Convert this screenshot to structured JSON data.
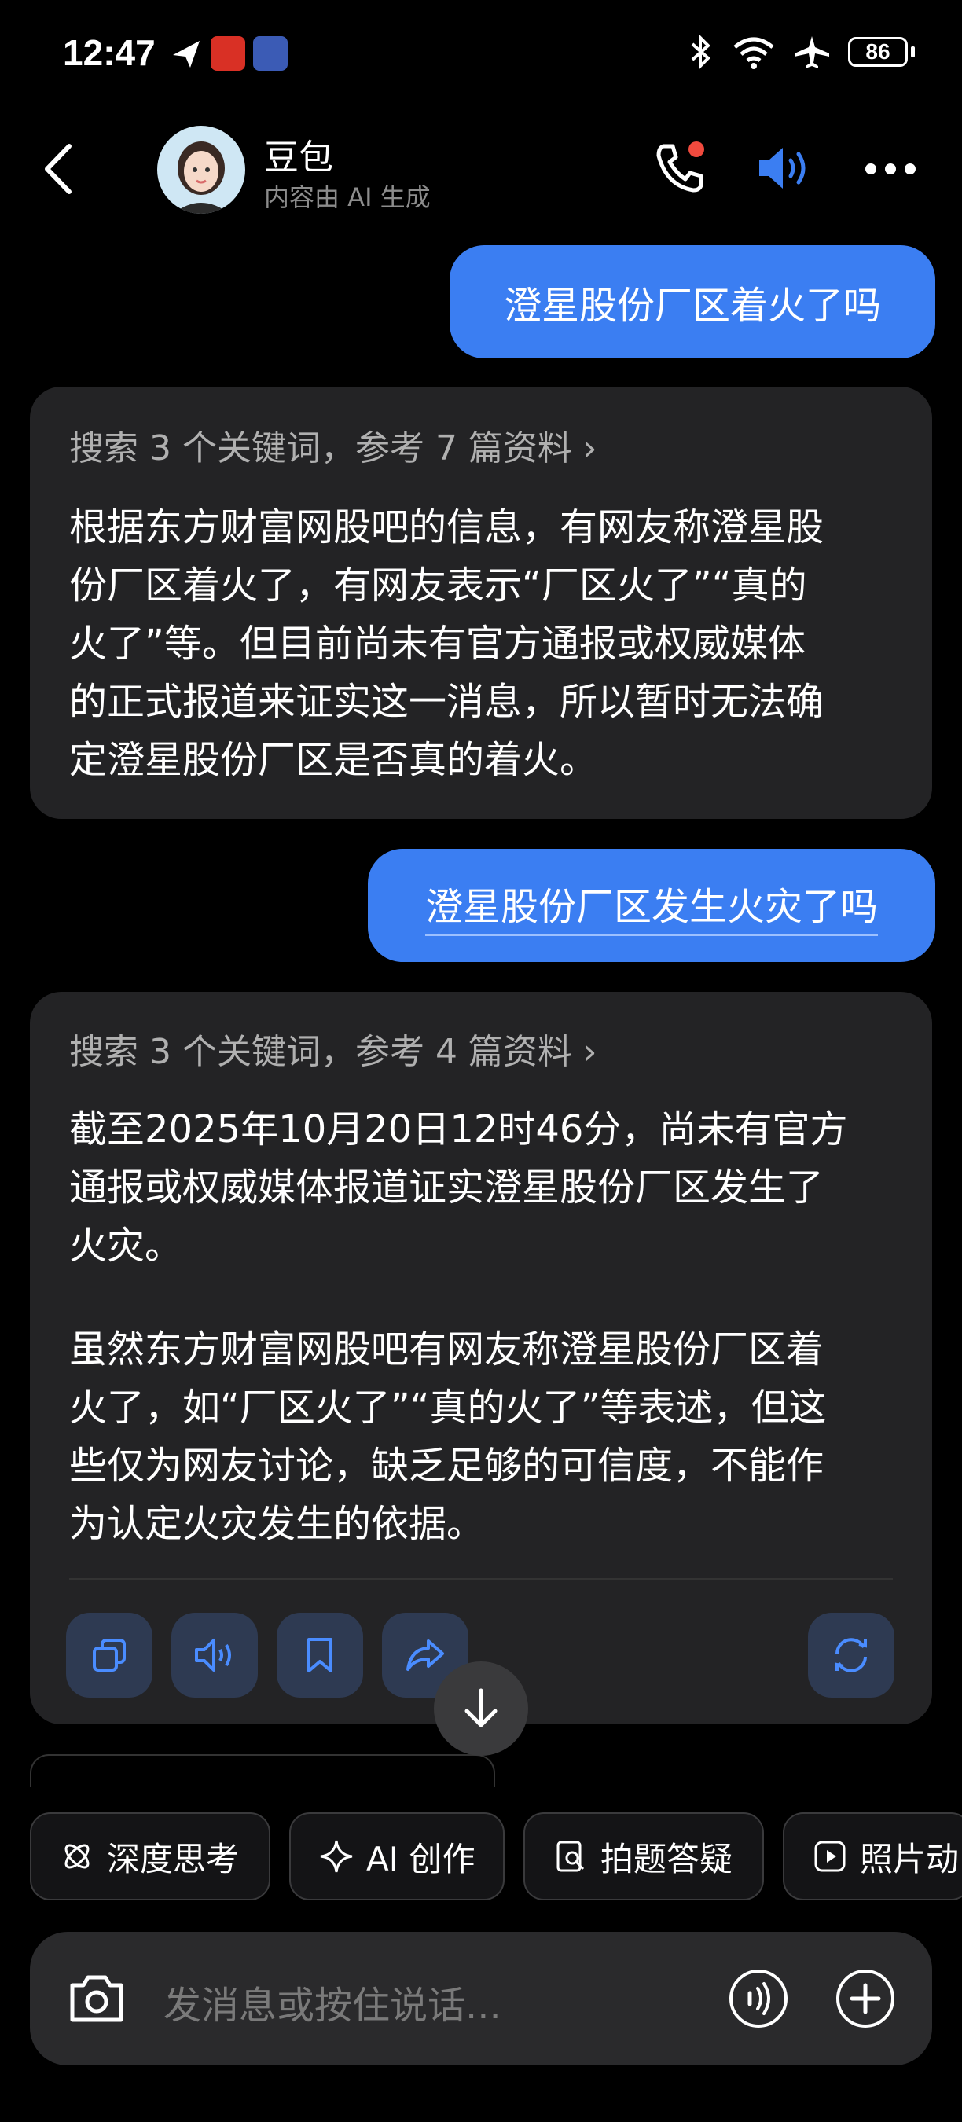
{
  "status_bar": {
    "time": "12:47",
    "battery": "86",
    "icons": [
      "location-icon",
      "app-notification-icon",
      "app-notification-icon",
      "bluetooth-icon",
      "wifi-icon",
      "airplane-icon",
      "battery-icon"
    ]
  },
  "header": {
    "name": "豆包",
    "subtitle": "内容由 AI 生成"
  },
  "messages": [
    {
      "role": "user",
      "text": "澄星股份厂区着火了吗"
    },
    {
      "role": "ai",
      "search": "搜索 3 个关键词，参考 7 篇资料",
      "lines": [
        "根据东方财富网股吧的信息，有网友称澄星股",
        "份厂区着火了，有网友表示“厂区火了”“真的",
        "火了”等。但目前尚未有官方通报或权威媒体",
        "的正式报道来证实这一消息，所以暂时无法确",
        "定澄星股份厂区是否真的着火。"
      ]
    },
    {
      "role": "user",
      "text": "澄星股份厂区发生火灾了吗"
    },
    {
      "role": "ai",
      "search": "搜索 3 个关键词，参考 4 篇资料",
      "para1": [
        "截至2025年10月20日12时46分，尚未有官方",
        "通报或权威媒体报道证实澄星股份厂区发生了",
        "火灾。"
      ],
      "para2": [
        "虽然东方财富网股吧有网友称澄星股份厂区着",
        "火了，如“厂区火了”“真的火了”等表述，但这",
        "些仅为网友讨论，缺乏足够的可信度，不能作",
        "为认定火灾发生的依据。"
      ]
    }
  ],
  "actions": [
    "copy-icon",
    "speaker-icon",
    "bookmark-icon",
    "share-icon",
    "regenerate-icon"
  ],
  "chips": [
    "深度思考",
    "AI 创作",
    "拍题答疑",
    "照片动"
  ],
  "input": {
    "placeholder": "发消息或按住说话..."
  },
  "colors": {
    "accent": "#3b7ef2",
    "card": "#232325",
    "background": "#000000"
  }
}
